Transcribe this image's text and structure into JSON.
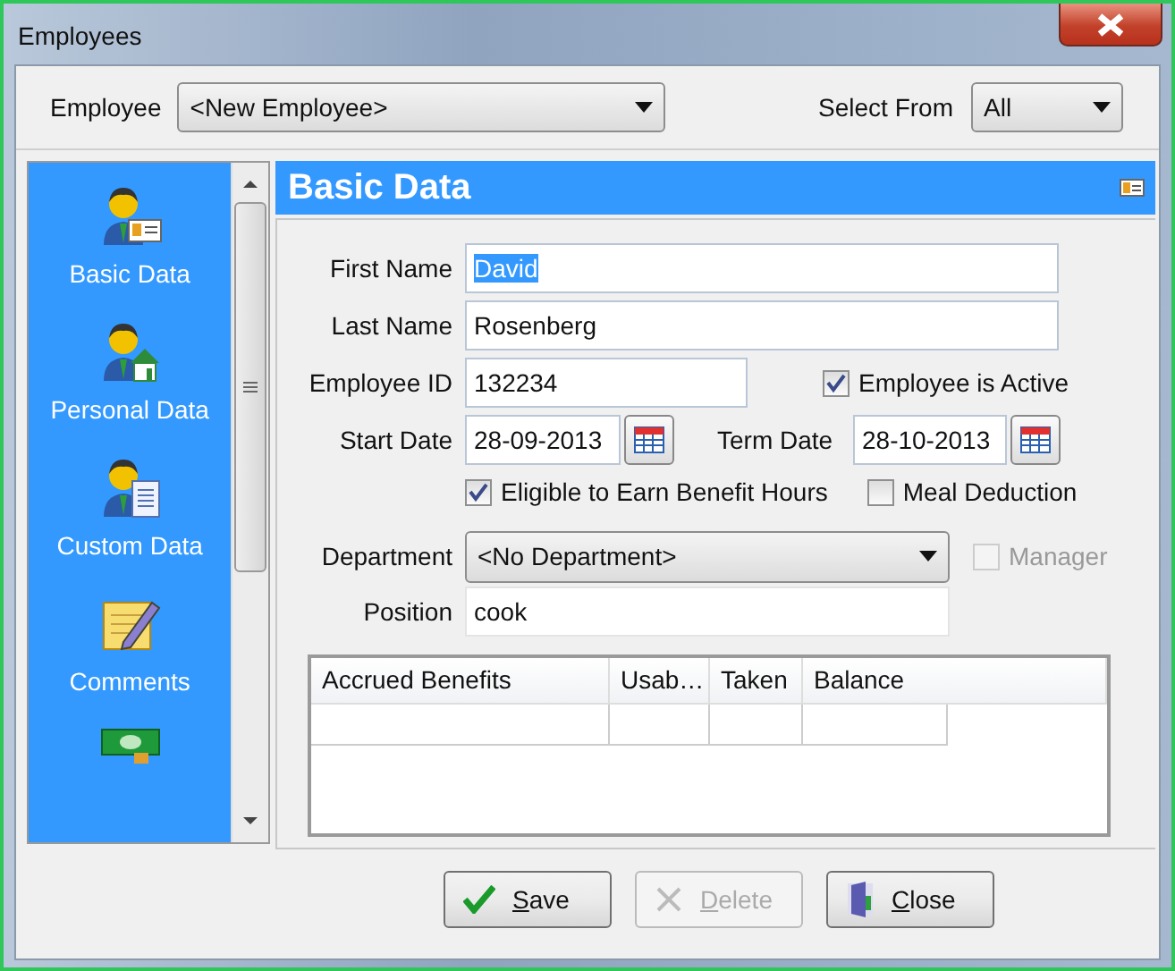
{
  "window": {
    "title": "Employees"
  },
  "employee_select": {
    "label": "Employee",
    "value": "<New Employee>"
  },
  "select_from": {
    "label": "Select From",
    "value": "All"
  },
  "sidebar": {
    "items": [
      {
        "kind": "basic",
        "label": "Basic Data"
      },
      {
        "kind": "personal",
        "label": "Personal Data"
      },
      {
        "kind": "custom",
        "label": "Custom Data"
      },
      {
        "kind": "comments",
        "label": "Comments"
      },
      {
        "kind": "money"
      }
    ]
  },
  "section": {
    "title": "Basic Data"
  },
  "form": {
    "first_name": {
      "label": "First Name",
      "value": "David",
      "text_selected": true
    },
    "last_name": {
      "label": "Last Name",
      "value": "Rosenberg"
    },
    "employee_id": {
      "label": "Employee ID",
      "value": "132234"
    },
    "employee_active": {
      "label": "Employee is Active",
      "checked": true,
      "disabled": false
    },
    "start_date": {
      "label": "Start Date",
      "value": "28-09-2013"
    },
    "term_date": {
      "label": "Term Date",
      "value": "28-10-2013"
    },
    "eligible_benefit_hours": {
      "label": "Eligible to Earn Benefit Hours",
      "checked": true,
      "disabled": false
    },
    "meal_deduction": {
      "label": "Meal Deduction",
      "checked": false,
      "disabled": false
    },
    "department": {
      "label": "Department",
      "value": "<No Department>"
    },
    "manager": {
      "label": "Manager",
      "checked": false,
      "disabled": true
    },
    "position": {
      "label": "Position",
      "value": "cook"
    }
  },
  "benefits_table": {
    "columns": [
      "Accrued Benefits",
      "Usab…",
      "Taken",
      "Balance"
    ]
  },
  "buttons": [
    {
      "kind": "save",
      "mnemonic": "S",
      "rest": "ave",
      "disabled": false
    },
    {
      "kind": "delete",
      "mnemonic": "D",
      "rest": "elete",
      "disabled": true
    },
    {
      "kind": "close",
      "mnemonic": "C",
      "rest": "lose",
      "disabled": false
    }
  ]
}
